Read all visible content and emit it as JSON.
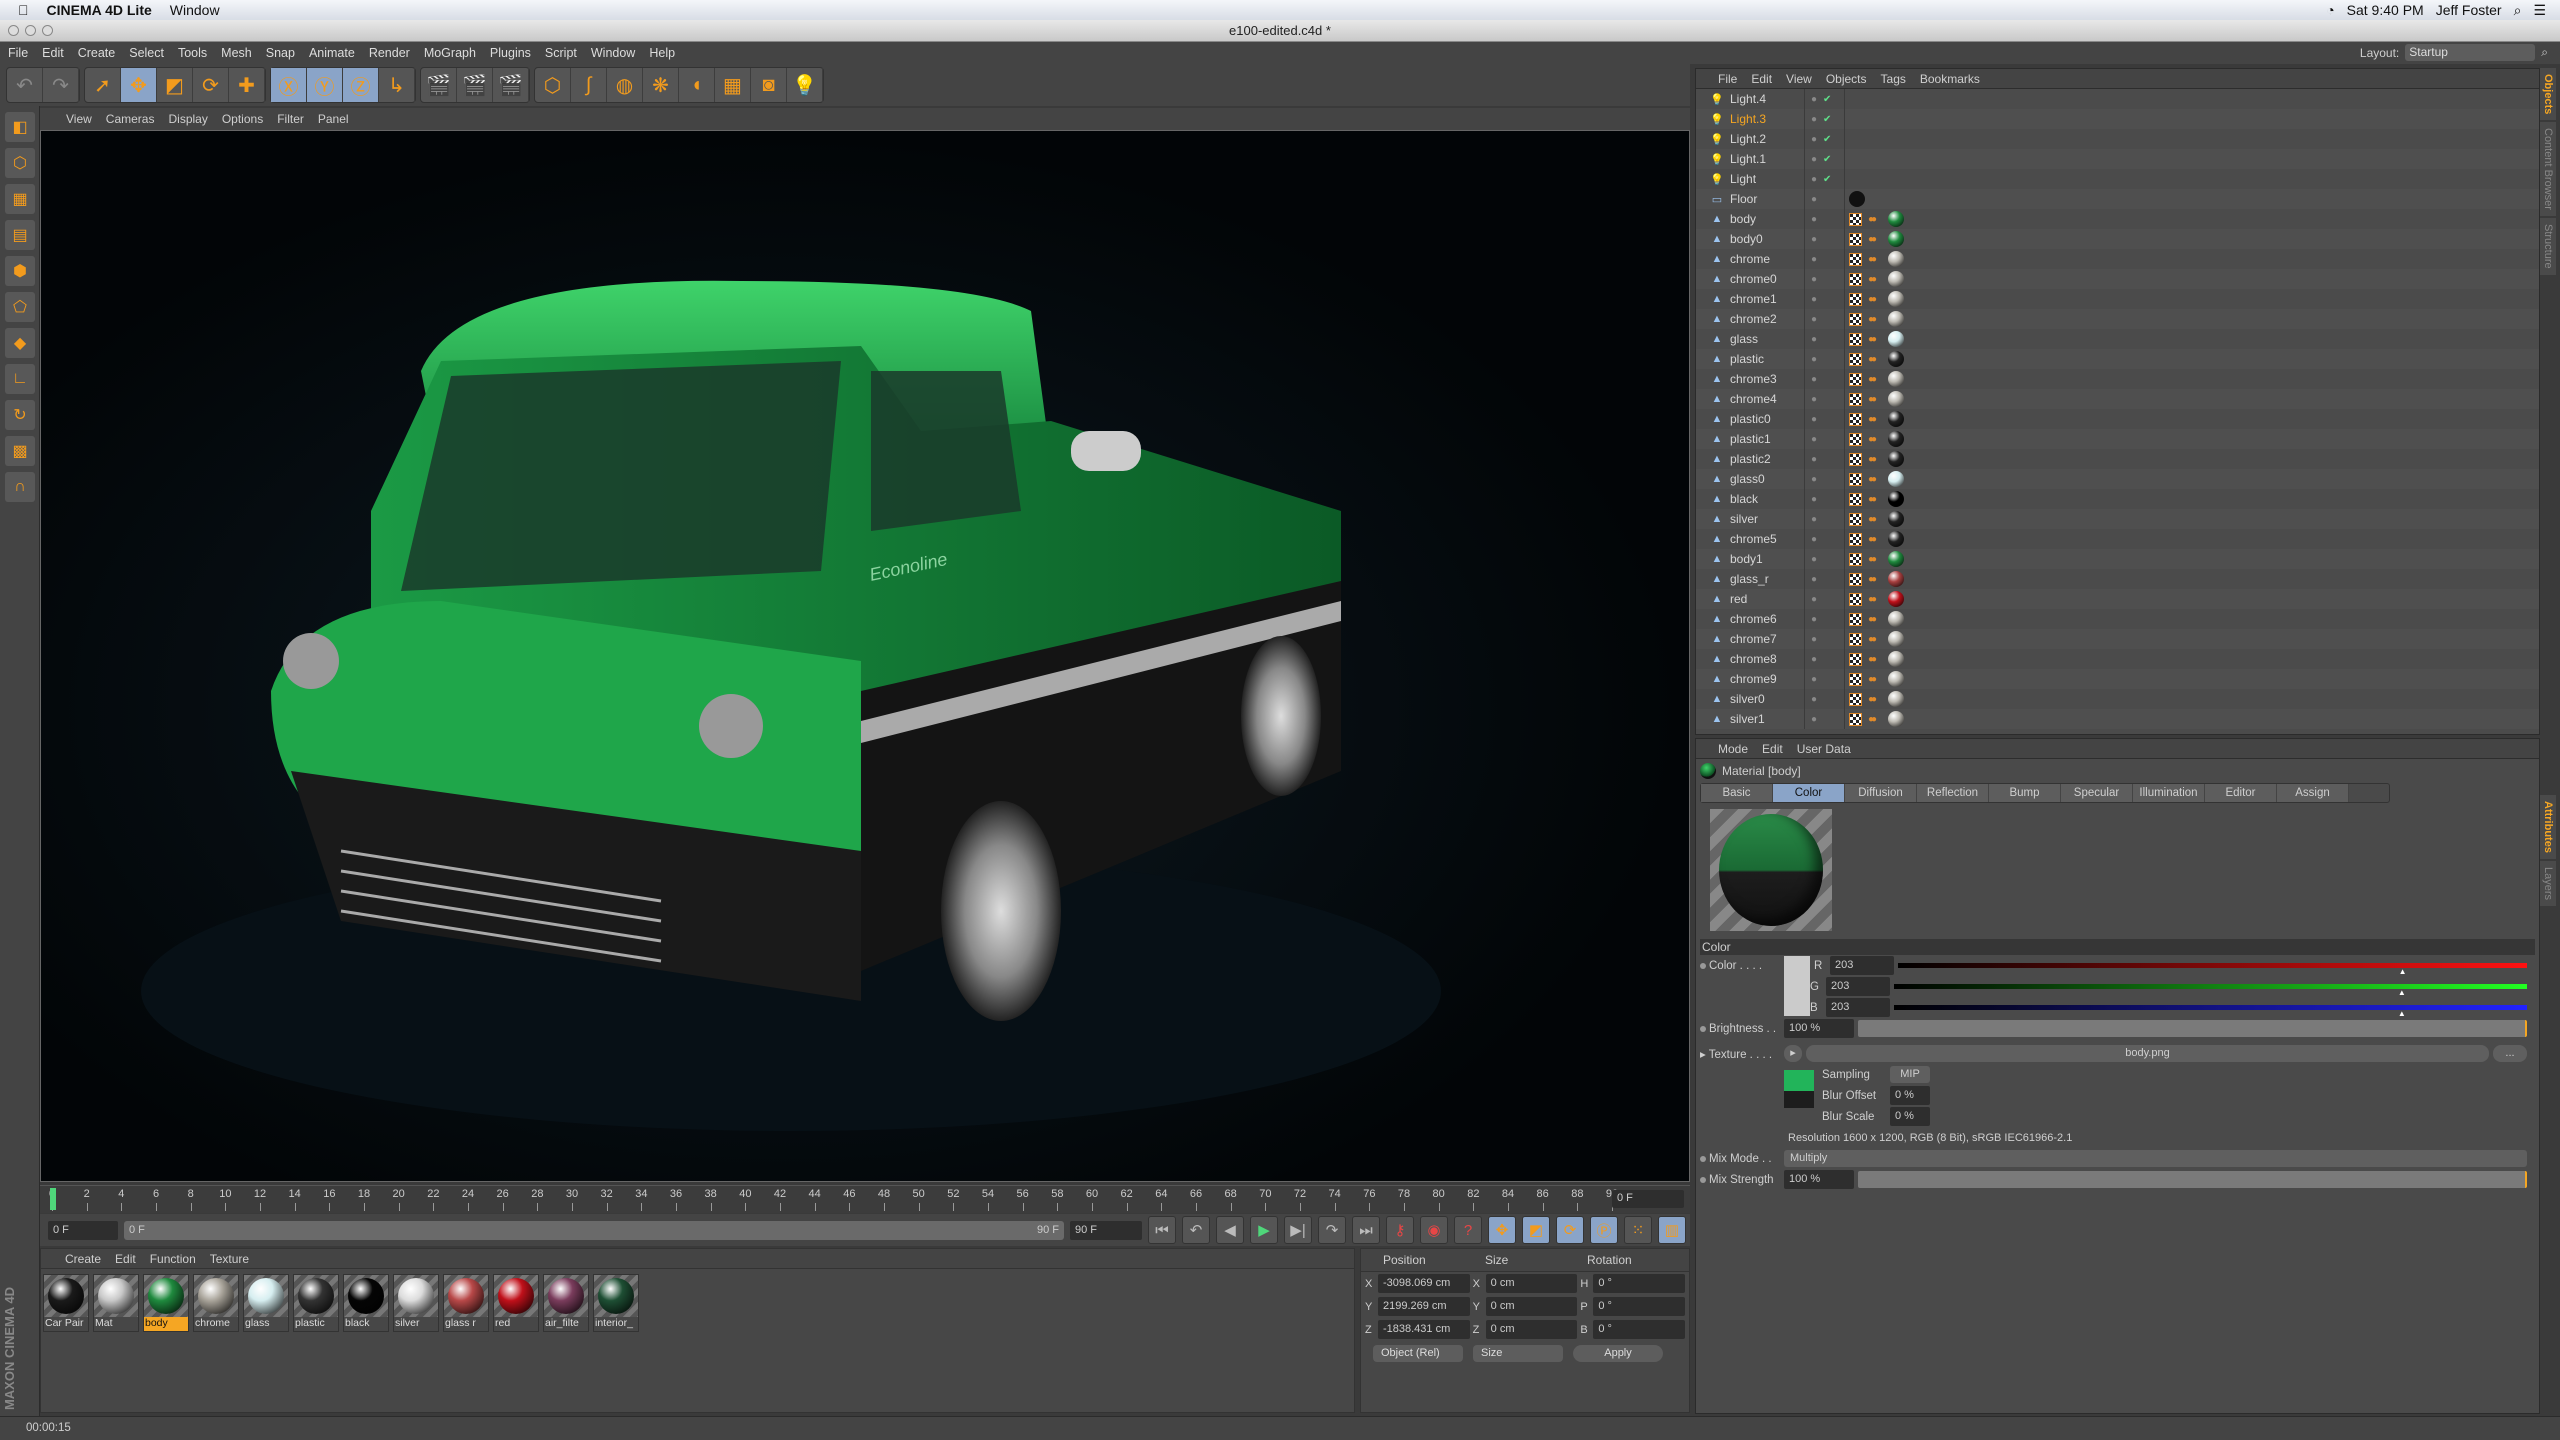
{
  "mac_menubar": {
    "app_name": "CINEMA 4D Lite",
    "menus": [
      "Window"
    ],
    "clock": "Sat 9:40 PM",
    "user": "Jeff Foster"
  },
  "window": {
    "title": "e100-edited.c4d *"
  },
  "app_menu": [
    "File",
    "Edit",
    "Create",
    "Select",
    "Tools",
    "Mesh",
    "Snap",
    "Animate",
    "Render",
    "MoGraph",
    "Plugins",
    "Script",
    "Window",
    "Help"
  ],
  "layout": {
    "label": "Layout:",
    "value": "Startup"
  },
  "toolbar_icons": [
    "undo-icon",
    "redo-icon",
    "live-selection-icon",
    "move-icon",
    "scale-icon",
    "rotate-icon",
    "add-icon",
    "x-axis-icon",
    "y-axis-icon",
    "z-axis-icon",
    "coordinate-system-icon",
    "render-view-icon",
    "render-picture-viewer-icon",
    "edit-render-settings-icon",
    "cube-icon",
    "spline-icon",
    "subdivision-surface-icon",
    "array-icon",
    "deformer-icon",
    "floor-icon",
    "camera-icon",
    "light-icon"
  ],
  "viewport_menu": [
    "View",
    "Cameras",
    "Display",
    "Options",
    "Filter",
    "Panel"
  ],
  "viewport": {
    "logo_text": "Econoline",
    "body_color": "#23a447"
  },
  "timeline": {
    "ticks": [
      0,
      2,
      4,
      6,
      8,
      10,
      12,
      14,
      16,
      18,
      20,
      22,
      24,
      26,
      28,
      30,
      32,
      34,
      36,
      38,
      40,
      42,
      44,
      46,
      48,
      50,
      52,
      54,
      56,
      58,
      60,
      62,
      64,
      66,
      68,
      70,
      72,
      74,
      76,
      78,
      80,
      82,
      84,
      86,
      88,
      90
    ],
    "current_frame": "0 F"
  },
  "transport": {
    "start": "0 F",
    "range_start": "0 F",
    "range_end": "90 F",
    "end": "90 F"
  },
  "material_manager": {
    "menu": [
      "Create",
      "Edit",
      "Function",
      "Texture"
    ],
    "materials": [
      {
        "name": "Car Pair",
        "color": "#1a1a1a"
      },
      {
        "name": "Mat",
        "color": "#c8c8c8"
      },
      {
        "name": "body",
        "color": "#1f8a3e",
        "selected": true
      },
      {
        "name": "chrome",
        "color": "#a9a49a"
      },
      {
        "name": "glass",
        "color": "#d6eef0"
      },
      {
        "name": "plastic",
        "color": "#333"
      },
      {
        "name": "black",
        "color": "#050505"
      },
      {
        "name": "silver",
        "color": "#dcdcdc"
      },
      {
        "name": "glass r",
        "color": "#b84848"
      },
      {
        "name": "red",
        "color": "#c0101a"
      },
      {
        "name": "air_filte",
        "color": "#7a3c5c"
      },
      {
        "name": "interior_",
        "color": "#1e4f34"
      }
    ]
  },
  "coordinates": {
    "headers": [
      "Position",
      "Size",
      "Rotation"
    ],
    "rows": [
      {
        "pa": "X",
        "pos": "-3098.069 cm",
        "sa": "X",
        "size": "0 cm",
        "ra": "H",
        "rot": "0 °"
      },
      {
        "pa": "Y",
        "pos": "2199.269 cm",
        "sa": "Y",
        "size": "0 cm",
        "ra": "P",
        "rot": "0 °"
      },
      {
        "pa": "Z",
        "pos": "-1838.431 cm",
        "sa": "Z",
        "size": "0 cm",
        "ra": "B",
        "rot": "0 °"
      }
    ],
    "mode": "Object (Rel)",
    "size_mode": "Size",
    "apply": "Apply"
  },
  "status_bar": {
    "time": "00:00:15"
  },
  "object_manager": {
    "menu": [
      "File",
      "Edit",
      "View",
      "Objects",
      "Tags",
      "Bookmarks"
    ],
    "objects": [
      {
        "name": "Light.4",
        "type": "light"
      },
      {
        "name": "Light.3",
        "type": "light",
        "selected": true
      },
      {
        "name": "Light.2",
        "type": "light"
      },
      {
        "name": "Light.1",
        "type": "light"
      },
      {
        "name": "Light",
        "type": "light"
      },
      {
        "name": "Floor",
        "type": "floor"
      },
      {
        "name": "body",
        "mat": "#1f8a3e"
      },
      {
        "name": "body0",
        "mat": "#1f8a3e"
      },
      {
        "name": "chrome",
        "mat": "#bdbab2"
      },
      {
        "name": "chrome0",
        "mat": "#bdbab2"
      },
      {
        "name": "chrome1",
        "mat": "#bdbab2"
      },
      {
        "name": "chrome2",
        "mat": "#bdbab2"
      },
      {
        "name": "glass",
        "mat": "#d6eef0"
      },
      {
        "name": "plastic",
        "mat": "#222"
      },
      {
        "name": "chrome3",
        "mat": "#bdbab2"
      },
      {
        "name": "chrome4",
        "mat": "#bdbab2"
      },
      {
        "name": "plastic0",
        "mat": "#222"
      },
      {
        "name": "plastic1",
        "mat": "#222"
      },
      {
        "name": "plastic2",
        "mat": "#222"
      },
      {
        "name": "glass0",
        "mat": "#d6eef0"
      },
      {
        "name": "black",
        "mat": "#000"
      },
      {
        "name": "silver",
        "mat": "#222"
      },
      {
        "name": "chrome5",
        "mat": "#222"
      },
      {
        "name": "body1",
        "mat": "#1f8a3e"
      },
      {
        "name": "glass_r",
        "mat": "#a84040"
      },
      {
        "name": "red",
        "mat": "#c0101a"
      },
      {
        "name": "chrome6",
        "mat": "#bdbab2"
      },
      {
        "name": "chrome7",
        "mat": "#bdbab2"
      },
      {
        "name": "chrome8",
        "mat": "#bdbab2"
      },
      {
        "name": "chrome9",
        "mat": "#bdbab2"
      },
      {
        "name": "silver0",
        "mat": "#bdbab2"
      },
      {
        "name": "silver1",
        "mat": "#bdbab2"
      }
    ]
  },
  "attributes": {
    "menu": [
      "Mode",
      "Edit",
      "User Data"
    ],
    "title": "Material [body]",
    "tabs": [
      "Basic",
      "Color",
      "Diffusion",
      "Reflection",
      "Bump",
      "Specular",
      "Illumination",
      "Editor",
      "Assign"
    ],
    "active_tab": "Color",
    "section": "Color",
    "color_label": "Color . . . .",
    "r_label": "R",
    "g_label": "G",
    "b_label": "B",
    "r": "203",
    "g": "203",
    "b": "203",
    "rgb_fraction": 0.796,
    "brightness_label": "Brightness . .",
    "brightness": "100 %",
    "texture_label": "Texture . . . .",
    "texture": "body.png",
    "browse": "...",
    "sampling_label": "Sampling",
    "sampling": "MIP",
    "blur_offset_label": "Blur Offset",
    "blur_offset": "0 %",
    "blur_scale_label": "Blur Scale",
    "blur_scale": "0 %",
    "resolution": "Resolution 1600 x 1200, RGB (8 Bit), sRGB IEC61966-2.1",
    "mix_mode_label": "Mix Mode . .",
    "mix_mode": "Multiply",
    "mix_strength_label": "Mix Strength",
    "mix_strength": "100 %"
  },
  "side_tabs": [
    "Objects",
    "Content Browser",
    "Structure"
  ],
  "side_tabs_lower": [
    "Attributes",
    "Layers"
  ],
  "branding": "MAXON CINEMA 4D"
}
